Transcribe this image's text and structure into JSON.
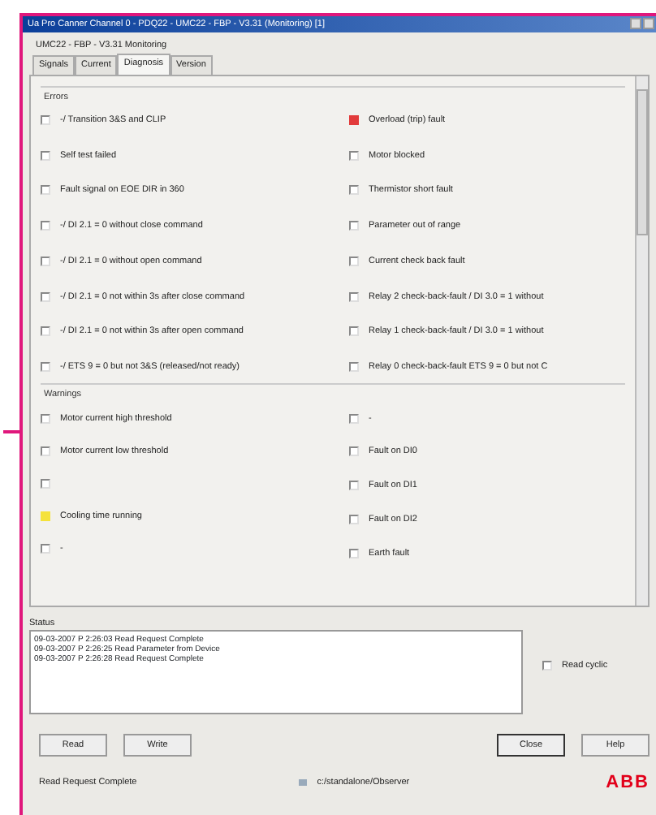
{
  "window": {
    "title": "Ua Pro Canner Channel 0 - PDQ22 - UMC22 - FBP - V3.31 (Monitoring) [1]"
  },
  "header": "UMC22 - FBP - V3.31 Monitoring",
  "tabs": [
    {
      "label": "Signals",
      "selected": false
    },
    {
      "label": "Current",
      "selected": false
    },
    {
      "label": "Diagnosis",
      "selected": true
    },
    {
      "label": "Version",
      "selected": false
    }
  ],
  "groups": [
    {
      "title": "Errors",
      "kind": "error",
      "columns": [
        [
          {
            "label": "-/ Transition 3&S and CLIP",
            "checked": false
          },
          {
            "label": "Self test failed",
            "checked": false
          },
          {
            "label": "Fault signal on EOE DIR in 360",
            "checked": false
          },
          {
            "label": "-/ DI 2.1 = 0 without close command",
            "checked": false
          },
          {
            "label": "-/ DI 2.1 = 0 without open command",
            "checked": false
          },
          {
            "label": "-/ DI 2.1 = 0 not within 3s after close command",
            "checked": false
          },
          {
            "label": "-/ DI 2.1 = 0 not within 3s after open command",
            "checked": false
          },
          {
            "label": "-/ ETS 9 = 0 but not 3&S (released/not ready)",
            "checked": false
          }
        ],
        [
          {
            "label": "Overload (trip) fault",
            "checked": true
          },
          {
            "label": "Motor blocked",
            "checked": false
          },
          {
            "label": "Thermistor short fault",
            "checked": false
          },
          {
            "label": "Parameter out of range",
            "checked": false
          },
          {
            "label": "Current check back fault",
            "checked": false
          },
          {
            "label": "Relay 2 check-back-fault / DI 3.0 = 1 without",
            "checked": false
          },
          {
            "label": "Relay 1 check-back-fault / DI 3.0 = 1 without",
            "checked": false
          },
          {
            "label": "Relay 0 check-back-fault ETS 9 = 0 but not C",
            "checked": false
          }
        ]
      ]
    },
    {
      "title": "Warnings",
      "kind": "warning",
      "columns": [
        [
          {
            "label": "Motor current high threshold",
            "checked": false
          },
          {
            "label": "Motor current low threshold",
            "checked": false
          },
          {
            "checked": false
          },
          {
            "label": "Cooling time running",
            "checked": true
          },
          {
            "label": "-",
            "checked": false
          }
        ],
        [
          {
            "label": "-",
            "checked": false
          },
          {
            "label": "Fault on DI0",
            "checked": false
          },
          {
            "label": "Fault on DI1",
            "checked": false
          },
          {
            "label": "Fault on DI2",
            "checked": false
          },
          {
            "label": "Earth fault",
            "checked": false
          }
        ]
      ]
    }
  ],
  "status": {
    "title": "Status",
    "log": [
      "09-03-2007 P 2:26:03 Read Request Complete",
      "09-03-2007 P 2:26:25 Read Parameter from Device",
      "09-03-2007 P 2:26:28 Read Request Complete"
    ],
    "read_cyclic": {
      "label": "Read cyclic",
      "checked": false
    }
  },
  "buttons": [
    {
      "label": "Read",
      "default": false
    },
    {
      "label": "Write",
      "default": false
    },
    {
      "label": "Close",
      "default": true
    },
    {
      "label": "Help",
      "default": false
    }
  ],
  "status_bar": {
    "message": "Read Request Complete",
    "path": "c:/standalone/Observer",
    "logo": "ABB"
  }
}
